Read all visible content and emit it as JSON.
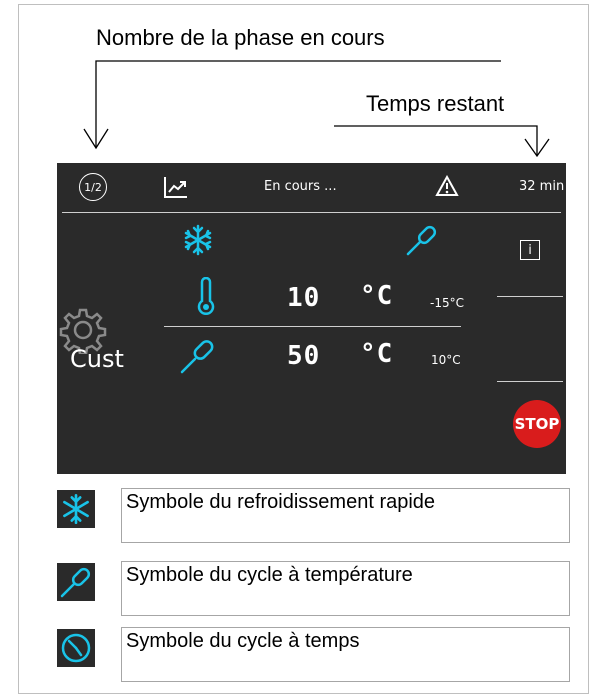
{
  "annotations": {
    "phase_label": "Nombre de la phase en cours",
    "time_label": "Temps restant"
  },
  "screen": {
    "status_bar": {
      "phase": "1/2",
      "status_text": "En cours ...",
      "remaining_time": "32 min"
    },
    "readings": [
      {
        "value": "10",
        "unit": "°C",
        "setpoint": "-15°C"
      },
      {
        "value": "50",
        "unit": "°C",
        "setpoint": "10°C"
      }
    ],
    "program_name": "Cust",
    "stop_label": "STOP"
  },
  "legend": [
    {
      "icon": "snowflake-icon",
      "text": "Symbole du refroidissement rapide"
    },
    {
      "icon": "probe-icon",
      "text": "Symbole du cycle à température"
    },
    {
      "icon": "clock-icon",
      "text": "Symbole du cycle à temps"
    }
  ],
  "colors": {
    "screen_bg": "#2a2a2a",
    "accent": "#19c3e8",
    "stop": "#d91c1c"
  }
}
